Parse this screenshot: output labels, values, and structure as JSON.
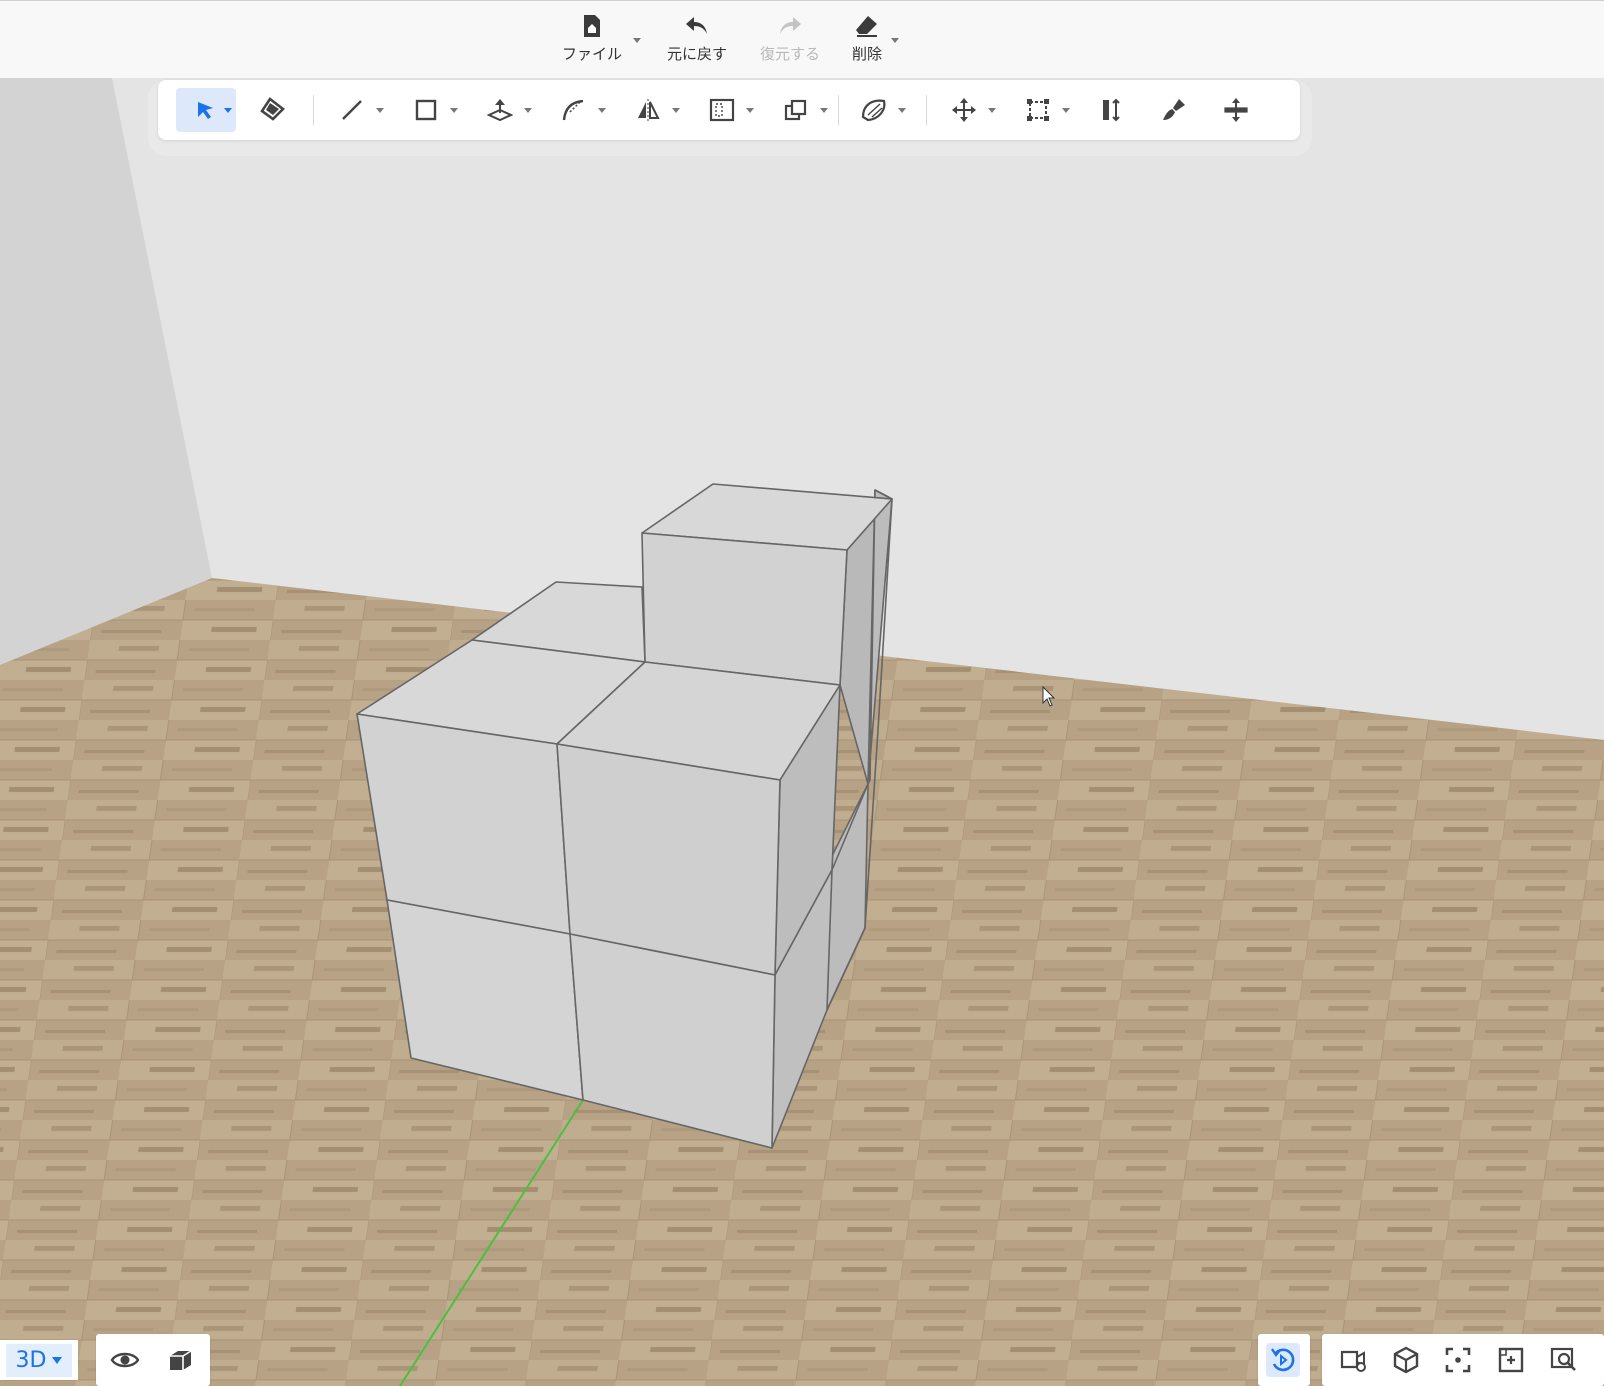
{
  "header": {
    "file_label": "ファイル",
    "undo_label": "元に戻す",
    "redo_label": "復元する",
    "delete_label": "削除"
  },
  "toolbar": {
    "tools": [
      "select-tool",
      "paint-bucket-tool",
      "line-tool",
      "rectangle-tool",
      "push-pull-tool",
      "arc-tool",
      "mirror-tool",
      "offset-tool",
      "copy-array-tool",
      "surface-tool",
      "move-tool",
      "scale-tool",
      "align-tool",
      "paint-brush-tool",
      "move-plane-tool"
    ],
    "active_tool": "select-tool",
    "accent_color": "#1a73e8"
  },
  "viewport": {
    "floor_color": "#b49f84",
    "wall_color": "#e4e4e4",
    "axis_color": "#3fbf3f",
    "block_color": "#d2d2d2"
  },
  "bottom_left": {
    "view_mode_label": "3D"
  },
  "bottom_right": {
    "orbit_active": true
  }
}
